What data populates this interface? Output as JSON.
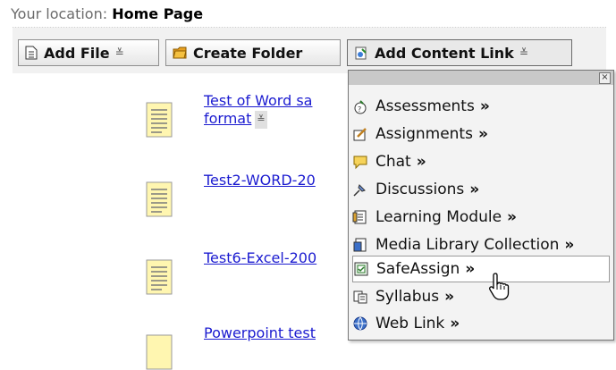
{
  "location": {
    "label": "Your location:",
    "value": "Home Page"
  },
  "toolbar": {
    "add_file": "Add File",
    "create_folder": "Create Folder",
    "add_content_link": "Add Content Link"
  },
  "items": [
    {
      "line1": "Test of Word sa",
      "line2": "format"
    },
    {
      "line1": "Test2-WORD-20"
    },
    {
      "line1": "Test6-Excel-200"
    },
    {
      "line1": "Powerpoint test"
    }
  ],
  "menu": {
    "close": "×",
    "items": [
      {
        "label": "Assessments",
        "icon": "assessment-icon"
      },
      {
        "label": "Assignments",
        "icon": "assignment-icon"
      },
      {
        "label": "Chat",
        "icon": "chat-icon"
      },
      {
        "label": "Discussions",
        "icon": "discussion-pin-icon"
      },
      {
        "label": "Learning Module",
        "icon": "learning-module-icon"
      },
      {
        "label": "Media Library Collection",
        "icon": "media-library-icon"
      },
      {
        "label": "SafeAssign",
        "icon": "safeassign-icon",
        "highlighted": true
      },
      {
        "label": "Syllabus",
        "icon": "syllabus-icon"
      },
      {
        "label": "Web Link",
        "icon": "web-link-icon"
      }
    ],
    "arrow": "»"
  },
  "colors": {
    "link": "#1b1bd0",
    "toolbar_bg": "#f1f1f1",
    "menu_bg": "#f3f3f3"
  }
}
